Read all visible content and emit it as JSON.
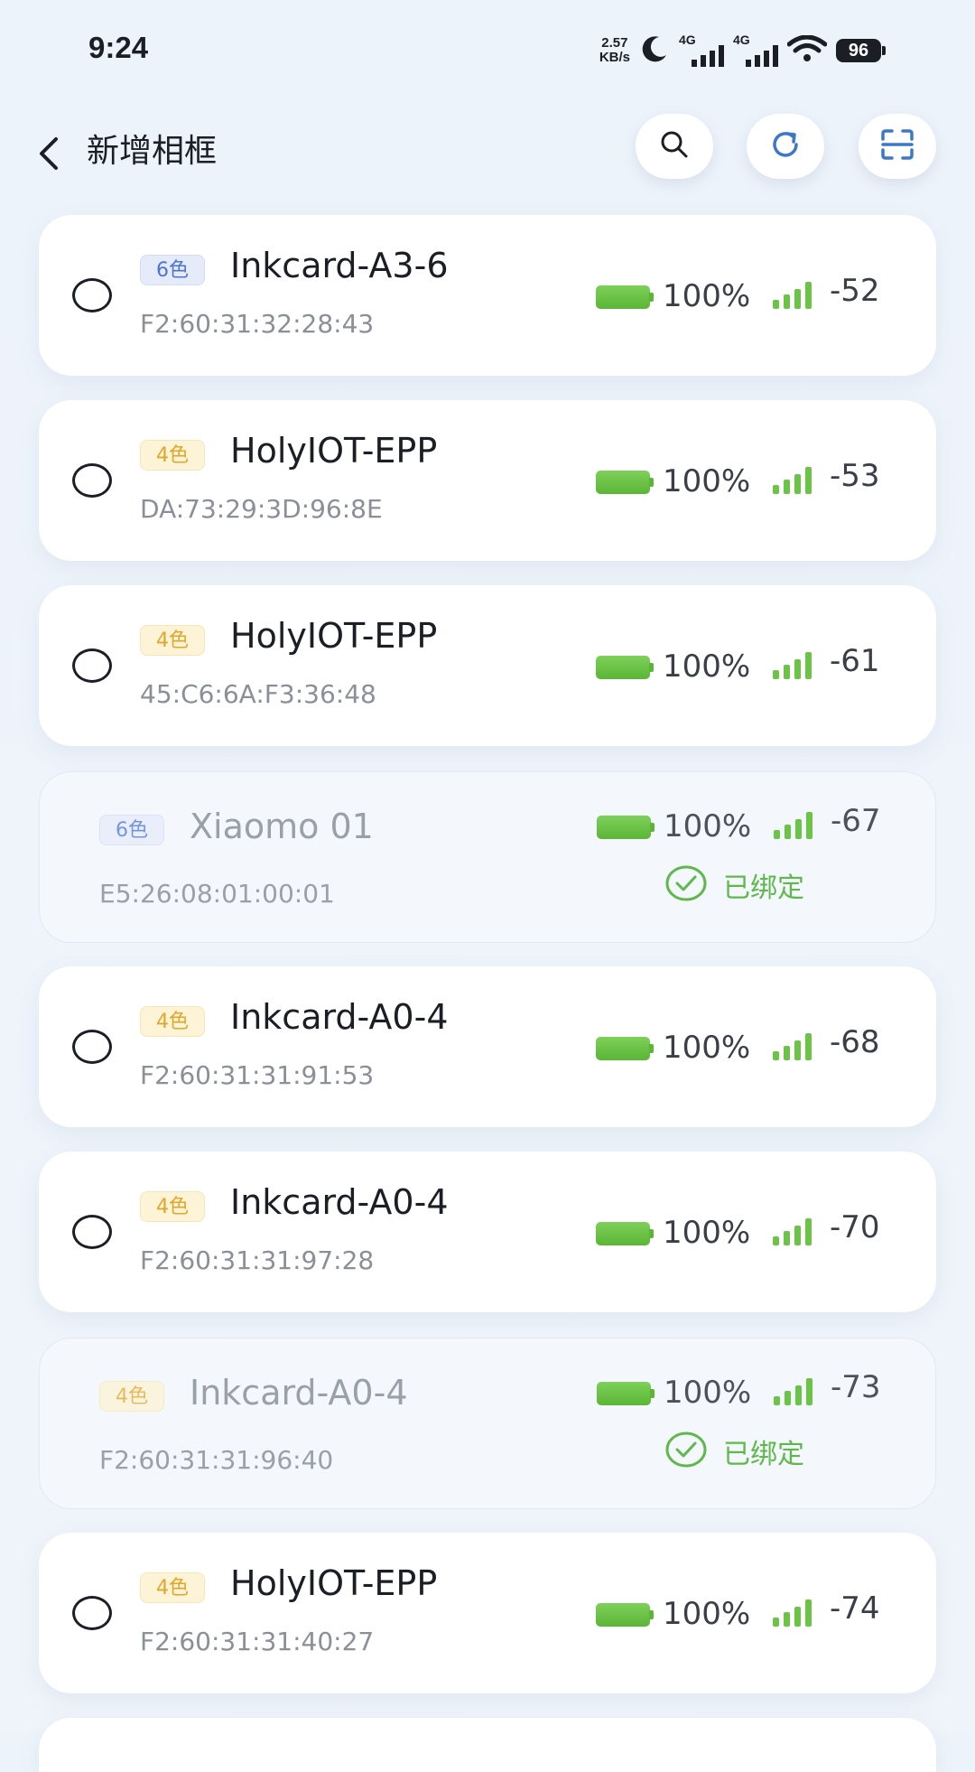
{
  "status_bar": {
    "time": "9:24",
    "net_speed_value": "2.57",
    "net_speed_unit": "KB/s",
    "sim1_label": "4G",
    "sim2_label": "4G",
    "battery": "96"
  },
  "header": {
    "title": "新增相框",
    "icons": [
      "back-chevron-icon",
      "search-icon",
      "refresh-icon",
      "scan-icon"
    ]
  },
  "colors": {
    "accent_blue": "#4b74d6",
    "badge_yellow": "#e0a72a",
    "success_green": "#5fb84a",
    "battery_green": "#6cc447"
  },
  "devices": [
    {
      "badge": "6色",
      "badge_type": "6",
      "name": "Inkcard-A3-6",
      "mac": "F2:60:31:32:28:43",
      "battery": "100%",
      "battery_level": 1.0,
      "rssi": "-52",
      "bound": false
    },
    {
      "badge": "4色",
      "badge_type": "4",
      "name": "HolyIOT-EPP",
      "mac": "DA:73:29:3D:96:8E",
      "battery": "100%",
      "battery_level": 1.0,
      "rssi": "-53",
      "bound": false
    },
    {
      "badge": "4色",
      "badge_type": "4",
      "name": "HolyIOT-EPP",
      "mac": "45:C6:6A:F3:36:48",
      "battery": "100%",
      "battery_level": 1.0,
      "rssi": "-61",
      "bound": false
    },
    {
      "badge": "6色",
      "badge_type": "6",
      "name": "Xiaomo 01",
      "mac": "E5:26:08:01:00:01",
      "battery": "100%",
      "battery_level": 1.0,
      "rssi": "-67",
      "bound": true,
      "bound_label": "已绑定"
    },
    {
      "badge": "4色",
      "badge_type": "4",
      "name": "Inkcard-A0-4",
      "mac": "F2:60:31:31:91:53",
      "battery": "100%",
      "battery_level": 1.0,
      "rssi": "-68",
      "bound": false
    },
    {
      "badge": "4色",
      "badge_type": "4",
      "name": "Inkcard-A0-4",
      "mac": "F2:60:31:31:97:28",
      "battery": "100%",
      "battery_level": 1.0,
      "rssi": "-70",
      "bound": false
    },
    {
      "badge": "4色",
      "badge_type": "4",
      "name": "Inkcard-A0-4",
      "mac": "F2:60:31:31:96:40",
      "battery": "100%",
      "battery_level": 1.0,
      "rssi": "-73",
      "bound": true,
      "bound_label": "已绑定"
    },
    {
      "badge": "4色",
      "badge_type": "4",
      "name": "HolyIOT-EPP",
      "mac": "F2:60:31:31:40:27",
      "battery": "100%",
      "battery_level": 1.0,
      "rssi": "-74",
      "bound": false
    }
  ]
}
